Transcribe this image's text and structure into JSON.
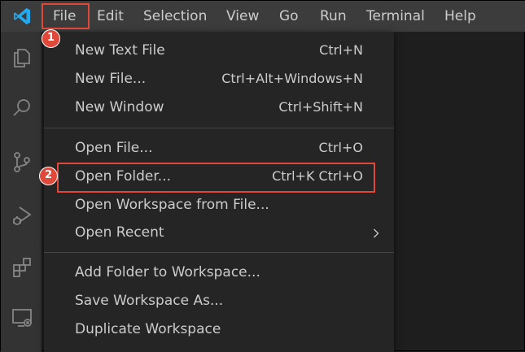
{
  "menubar": {
    "items": [
      "File",
      "Edit",
      "Selection",
      "View",
      "Go",
      "Run",
      "Terminal",
      "Help"
    ]
  },
  "activity_bar": {
    "icons": [
      "explorer-icon",
      "search-icon",
      "source-control-icon",
      "run-debug-icon",
      "extensions-icon",
      "remote-explorer-icon"
    ]
  },
  "file_menu": {
    "group1": [
      {
        "label": "New Text File",
        "shortcut": "Ctrl+N"
      },
      {
        "label": "New File...",
        "shortcut": "Ctrl+Alt+Windows+N"
      },
      {
        "label": "New Window",
        "shortcut": "Ctrl+Shift+N"
      }
    ],
    "group2": [
      {
        "label": "Open File...",
        "shortcut": "Ctrl+O"
      },
      {
        "label": "Open Folder...",
        "shortcut": "Ctrl+K Ctrl+O"
      },
      {
        "label": "Open Workspace from File...",
        "shortcut": ""
      },
      {
        "label": "Open Recent",
        "shortcut": ""
      }
    ],
    "group3": [
      {
        "label": "Add Folder to Workspace...",
        "shortcut": ""
      },
      {
        "label": "Save Workspace As...",
        "shortcut": ""
      },
      {
        "label": "Duplicate Workspace",
        "shortcut": ""
      }
    ]
  },
  "annotations": {
    "step1": "1",
    "step2": "2",
    "highlight_color": "#e0483a"
  },
  "colors": {
    "menubar_bg": "#3c3c3c",
    "activitybar_bg": "#333333",
    "menu_bg": "#252526",
    "editor_bg": "#1e1e1e",
    "logo": "#23a9f2"
  }
}
